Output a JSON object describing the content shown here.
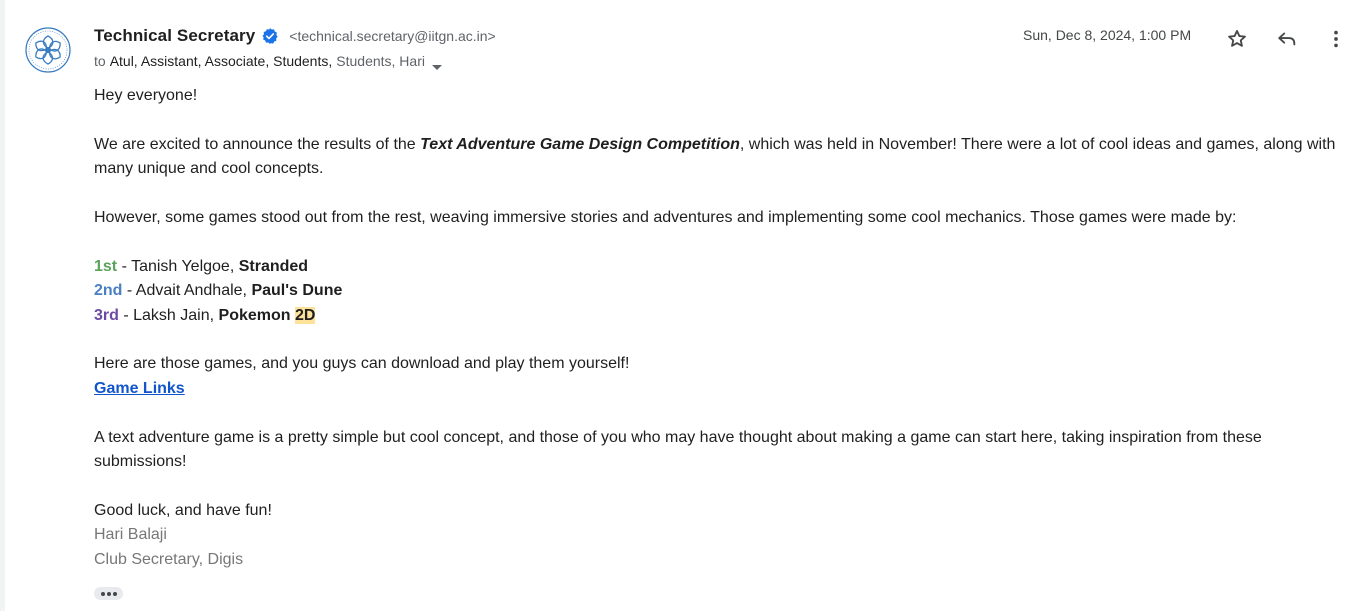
{
  "sender": {
    "name": "Technical Secretary",
    "email": "<technical.secretary@iitgn.ac.in>",
    "verified_icon": "verified-badge-icon",
    "avatar_icon": "institute-logo"
  },
  "recipients": {
    "to_label": "to",
    "names": "Atul, Assistant, Associate, Students,",
    "more": "Students, Hari"
  },
  "date": "Sun, Dec 8, 2024, 1:00 PM",
  "actions": {
    "star_icon": "star-icon",
    "reply_icon": "reply-icon",
    "more_icon": "more-vert-icon"
  },
  "body": {
    "greeting": "Hey everyone!",
    "p1_before": "We are excited to announce the results of the ",
    "p1_title": "Text Adventure Game Design Competition",
    "p1_after": ", which was held in November! There were a lot of cool ideas and games, along with many unique and cool concepts.",
    "p2": "However, some games stood out from the rest, weaving immersive stories and adventures and implementing some cool mechanics. Those games were made by:",
    "results": [
      {
        "place": "1st",
        "sep": " - ",
        "name": "Tanish Yelgoe, ",
        "game": "Stranded",
        "game_hl": ""
      },
      {
        "place": "2nd",
        "sep": " - ",
        "name": "Advait Andhale, ",
        "game": "Paul's Dune",
        "game_hl": ""
      },
      {
        "place": "3rd",
        "sep": " - ",
        "name": "Laksh Jain, ",
        "game": "Pokemon ",
        "game_hl": "2D"
      }
    ],
    "p3": "Here are those games, and you guys can download and play them yourself!",
    "link": "Game Links",
    "p4": "A text adventure game is a pretty simple but cool concept, and those of you who may have thought about making a game can start here, taking inspiration from these submissions!",
    "closing": "Good luck, and have fun!",
    "signature_name": "Hari Balaji",
    "signature_title": "Club Secretary, Digis"
  },
  "colors": {
    "first": "#5aa35a",
    "second": "#4a7fc1",
    "third": "#6b4aa3",
    "link": "#1155cc",
    "highlight": "#fde29a"
  }
}
